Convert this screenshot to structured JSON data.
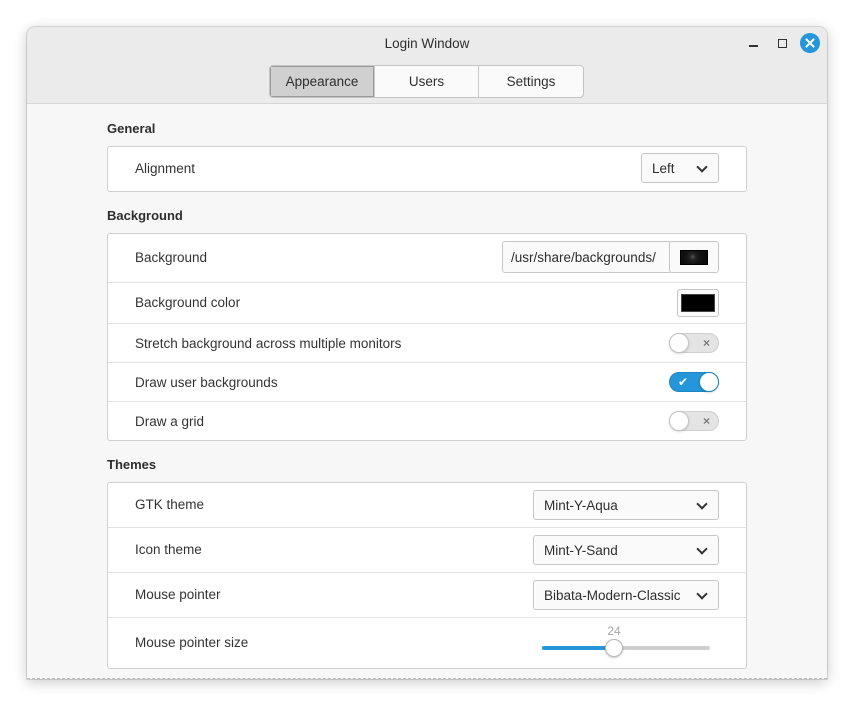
{
  "window": {
    "title": "Login Window"
  },
  "tabs": [
    {
      "label": "Appearance",
      "active": true
    },
    {
      "label": "Users",
      "active": false
    },
    {
      "label": "Settings",
      "active": false
    }
  ],
  "general": {
    "title": "General",
    "alignment": {
      "label": "Alignment",
      "value": "Left"
    }
  },
  "background": {
    "title": "Background",
    "file": {
      "label": "Background",
      "value": "/usr/share/backgrounds/"
    },
    "color": {
      "label": "Background color",
      "value": "#000000"
    },
    "stretch": {
      "label": "Stretch background across multiple monitors",
      "enabled": false
    },
    "draw_user": {
      "label": "Draw user backgrounds",
      "enabled": true
    },
    "draw_grid": {
      "label": "Draw a grid",
      "enabled": false
    }
  },
  "themes": {
    "title": "Themes",
    "gtk": {
      "label": "GTK theme",
      "value": "Mint-Y-Aqua"
    },
    "icon": {
      "label": "Icon theme",
      "value": "Mint-Y-Sand"
    },
    "pointer": {
      "label": "Mouse pointer",
      "value": "Bibata-Modern-Classic"
    },
    "pointer_size": {
      "label": "Mouse pointer size",
      "value": "24",
      "fraction": 0.43
    }
  },
  "colors": {
    "accent": "#2596d9"
  }
}
